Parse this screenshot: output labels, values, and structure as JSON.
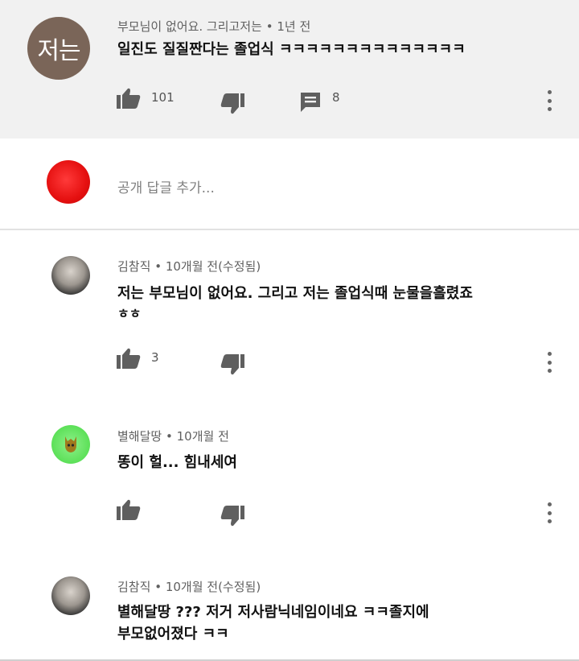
{
  "top_comment": {
    "avatar_text": "저는",
    "author": "부모님이 없어요. 그리고저는",
    "time": "1년 전",
    "text": "일진도 질질짠다는 졸업식 ㅋㅋㅋㅋㅋㅋㅋㅋㅋㅋㅋㅋㅋㅋ",
    "likes": "101",
    "replies": "8"
  },
  "reply_box": {
    "placeholder": "공개 답글 추가..."
  },
  "replies": [
    {
      "author": "김참직",
      "time": "10개월 전(수정됨)",
      "line1": "저는 부모님이 없어요. 그리고 저는 졸업식때 눈물을흘렸죠",
      "line2": "ㅎㅎ",
      "likes": "3"
    },
    {
      "author": "별해달땅",
      "time": "10개월 전",
      "line1": "똥이 헐... 힘내세여",
      "likes": ""
    },
    {
      "author": "김참직",
      "time": "10개월 전(수정됨)",
      "line1": "별해달땅 ??? 저거 저사람닉네임이네요 ㅋㅋ졸지에",
      "line2": "부모없어졌다 ㅋㅋ"
    }
  ],
  "separator": "•",
  "icons": {
    "like": "thumbs-up-icon",
    "dislike": "thumbs-down-icon",
    "reply": "comment-icon",
    "more": "more-vert-icon"
  }
}
